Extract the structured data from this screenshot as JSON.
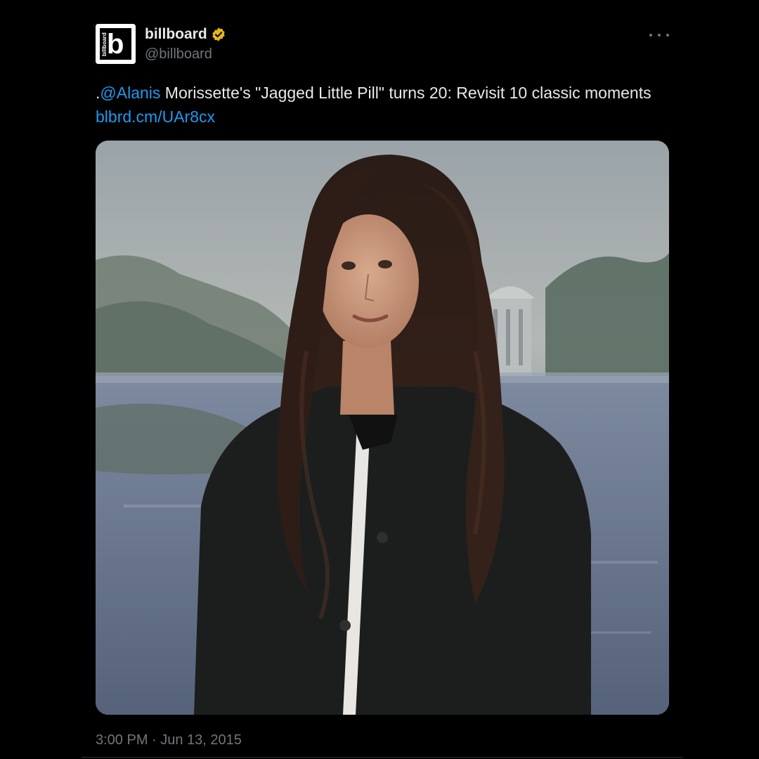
{
  "author": {
    "display_name": "billboard",
    "handle": "@billboard",
    "verified": true,
    "verified_color": "#e2b719",
    "avatar_letter": "b",
    "avatar_side_text": "billboard",
    "avatar_icon": "billboard-logo"
  },
  "tweet": {
    "prefix": ".",
    "mention": "@Alanis",
    "body": " Morissette's \"Jagged Little Pill\" turns 20: Revisit 10 classic moments ",
    "link": "blbrd.cm/UAr8cx",
    "link_color": "#1d9bf0"
  },
  "media": {
    "alt": "Portrait of Alanis Morissette with long dark wavy hair wearing a black leather jacket in front of a painted lake backdrop"
  },
  "meta": {
    "timestamp": "3:00 PM · Jun 13, 2015"
  },
  "icons": {
    "more": "more-horizontal-icon",
    "verified": "verified-badge-icon"
  }
}
